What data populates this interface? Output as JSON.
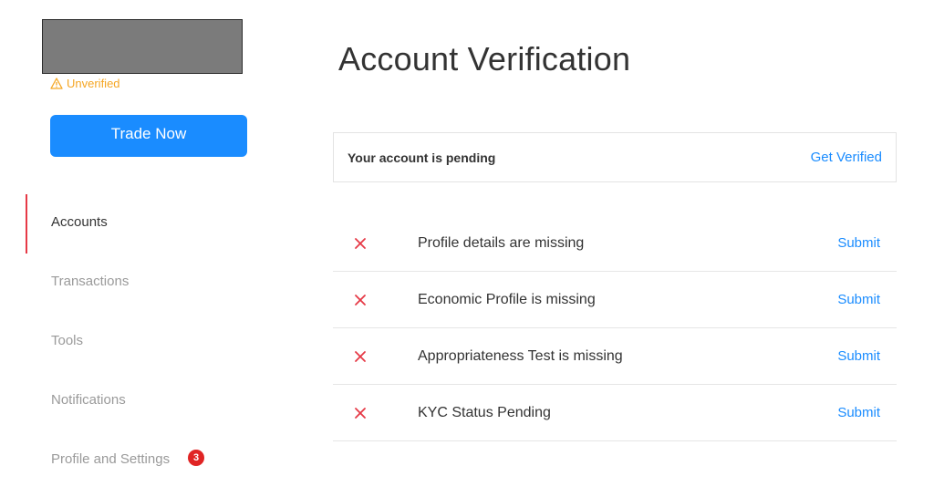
{
  "sidebar": {
    "status": "Unverified",
    "trade_button": "Trade Now",
    "nav": [
      {
        "label": "Accounts",
        "active": true
      },
      {
        "label": "Transactions",
        "active": false
      },
      {
        "label": "Tools",
        "active": false
      },
      {
        "label": "Notifications",
        "active": false
      },
      {
        "label": "Profile and Settings",
        "active": false,
        "badge": "3"
      }
    ]
  },
  "main": {
    "title": "Account Verification",
    "pending": {
      "message": "Your account is pending",
      "action": "Get Verified"
    },
    "checklist": [
      {
        "text": "Profile details are missing",
        "action": "Submit",
        "icon": "x-icon"
      },
      {
        "text": "Economic Profile is missing",
        "action": "Submit",
        "icon": "x-icon"
      },
      {
        "text": "Appropriateness Test is missing",
        "action": "Submit",
        "icon": "x-icon"
      },
      {
        "text": "KYC Status Pending",
        "action": "Submit",
        "icon": "x-icon"
      }
    ]
  },
  "colors": {
    "accent": "#1a8cff",
    "warning": "#f5a623",
    "error": "#e63946",
    "badge": "#e02424"
  }
}
